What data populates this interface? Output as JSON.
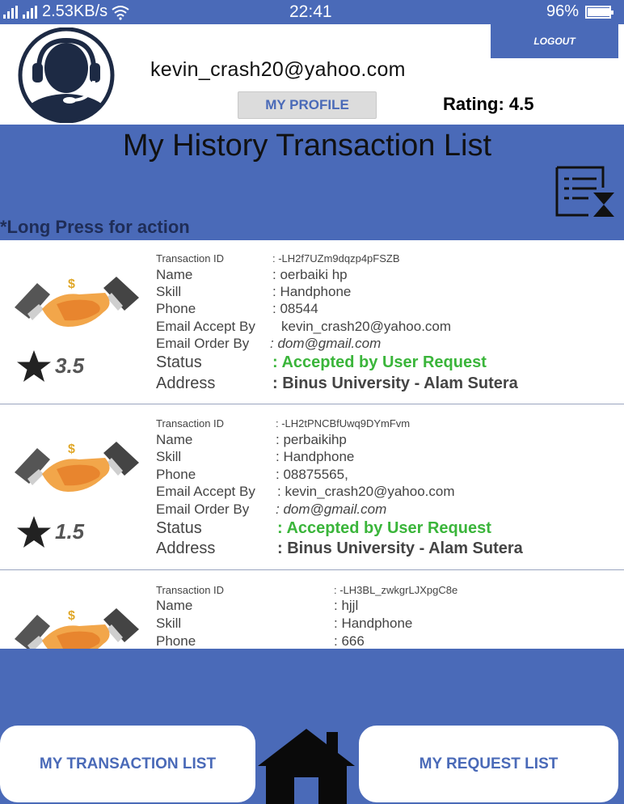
{
  "status_bar": {
    "speed": "2.53KB/s",
    "time": "22:41",
    "battery": "96%",
    "battery_level": 0.96,
    "icons": [
      "signal-icon",
      "wifi-icon",
      "battery-icon"
    ]
  },
  "header": {
    "email": "kevin_crash20@yahoo.com",
    "profile_button": "MY PROFILE",
    "rating": "Rating: 4.5",
    "logout": "LOGOUT"
  },
  "banner": {
    "title": "My History Transaction List",
    "hint": "*Long Press for action"
  },
  "labels": {
    "transaction_id": "Transaction ID",
    "name": "Name",
    "skill": "Skill",
    "phone": "Phone",
    "email_accept": "Email Accept By",
    "email_order": "Email Order By",
    "status": "Status",
    "address": "Address"
  },
  "transactions": [
    {
      "id": ": -LH2f7UZm9dqzp4pFSZB",
      "name": ": oerbaiki hp",
      "skill": ": Handphone",
      "phone": ": 08544",
      "email_accept": "kevin_crash20@yahoo.com",
      "email_order": ": dom@gmail.com",
      "status": ": Accepted by User Request",
      "address": ": Binus University - Alam Sutera",
      "rating": "3.5"
    },
    {
      "id": ": -LH2tPNCBfUwq9DYmFvm",
      "name": ": perbaikihp",
      "skill": ": Handphone",
      "phone": ": 08875565,",
      "email_accept": ": kevin_crash20@yahoo.com",
      "email_order": ": dom@gmail.com",
      "status": ": Accepted by User Request",
      "address": ": Binus University - Alam Sutera",
      "rating": "1.5"
    },
    {
      "id": ": -LH3BL_zwkgrLJXpgC8e",
      "name": ": hjjl",
      "skill": ": Handphone",
      "phone": ": 666"
    }
  ],
  "bottom_nav": {
    "left": "MY TRANSACTION LIST",
    "right": "MY REQUEST LIST"
  },
  "colors": {
    "primary": "#4a6ab8",
    "status_green": "#3ab53a",
    "hint_text": "#1f2d57"
  }
}
